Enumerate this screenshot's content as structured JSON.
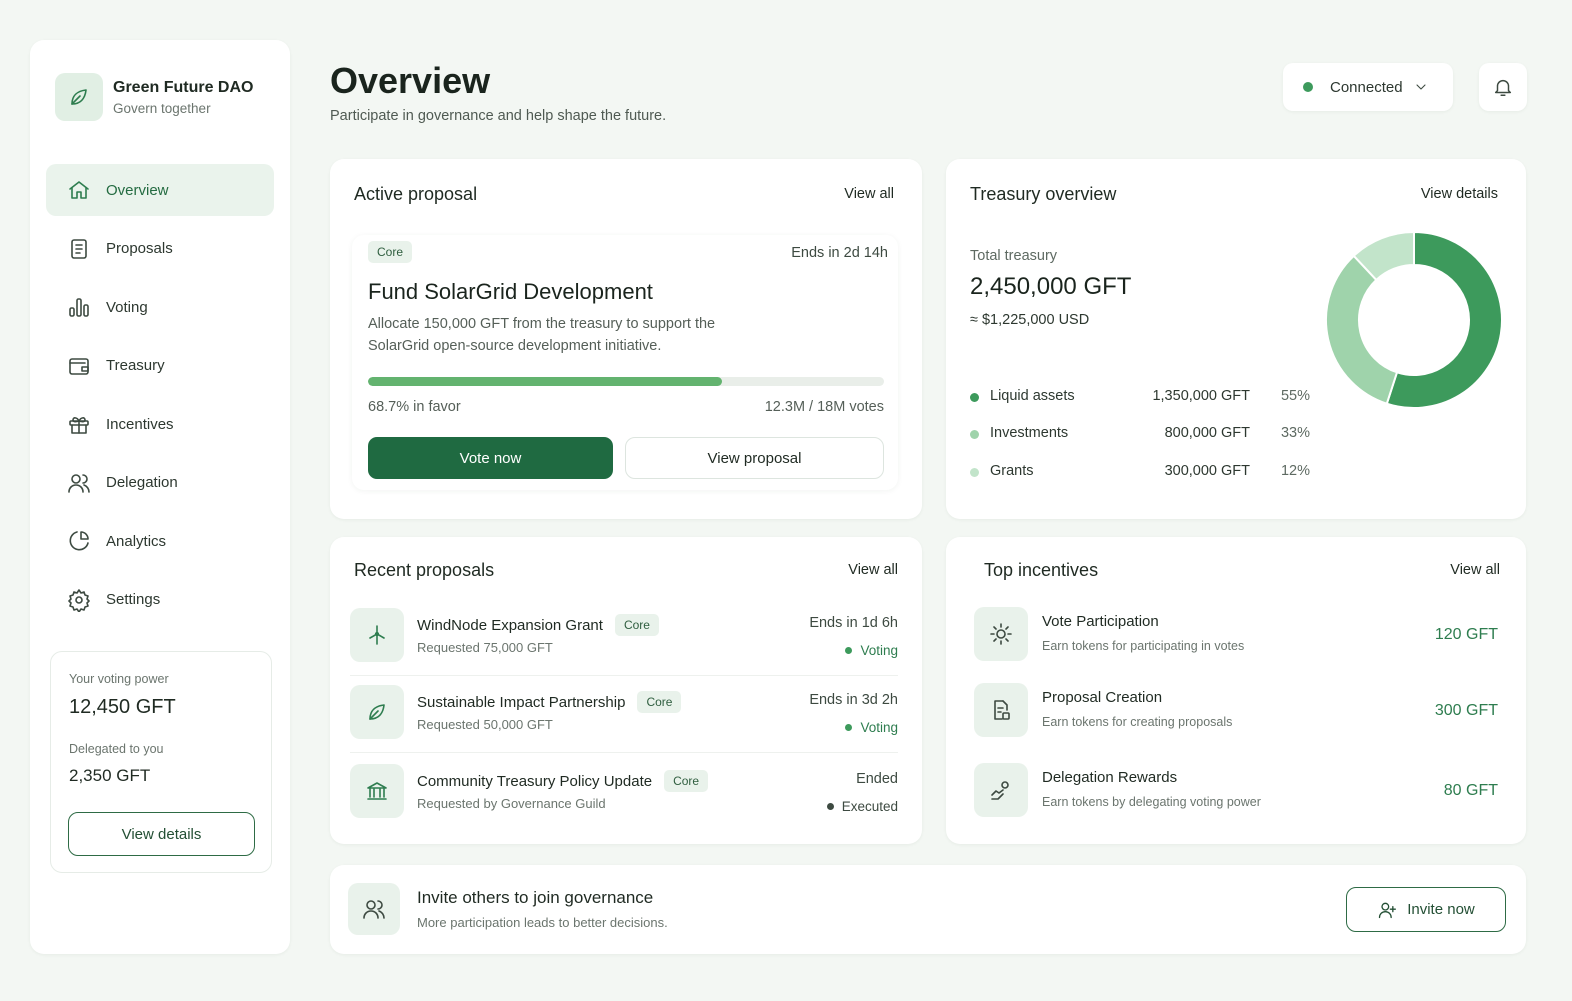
{
  "brand": {
    "name": "Green Future DAO",
    "tagline": "Govern together"
  },
  "nav": [
    {
      "label": "Overview",
      "icon": "home-icon",
      "active": true
    },
    {
      "label": "Proposals",
      "icon": "document-icon"
    },
    {
      "label": "Voting",
      "icon": "bar-chart-icon"
    },
    {
      "label": "Treasury",
      "icon": "wallet-icon"
    },
    {
      "label": "Incentives",
      "icon": "gift-icon"
    },
    {
      "label": "Delegation",
      "icon": "users-icon"
    },
    {
      "label": "Analytics",
      "icon": "pie-chart-icon"
    },
    {
      "label": "Settings",
      "icon": "gear-icon"
    }
  ],
  "voting_power": {
    "label": "Your voting power",
    "value": "12,450 GFT",
    "delegated_label": "Delegated to you",
    "delegated_value": "2,350 GFT",
    "button": "View details"
  },
  "header": {
    "title": "Overview",
    "subtitle": "Participate in governance and help shape the future.",
    "connection": "Connected"
  },
  "active_proposal": {
    "title": "Active proposal",
    "link": "View all",
    "tag": "Core",
    "ends": "Ends in 2d 14h",
    "name": "Fund SolarGrid Development",
    "desc_line1": "Allocate 150,000 GFT from the treasury to support the",
    "desc_line2": "SolarGrid open-source development initiative.",
    "progress": 0.687,
    "in_favor": "68.7% in favor",
    "votes": "12.3M / 18M votes",
    "vote_button": "Vote now",
    "view_button": "View proposal"
  },
  "treasury": {
    "title": "Treasury overview",
    "link": "View details",
    "total_label": "Total treasury",
    "total": "2,450,000 GFT",
    "usd": "≈ $1,225,000 USD",
    "breakdown": [
      {
        "name": "Liquid assets",
        "amount": "1,350,000 GFT",
        "pct": "55%",
        "value": 55,
        "color": "#3d9a5c"
      },
      {
        "name": "Investments",
        "amount": "800,000 GFT",
        "pct": "33%",
        "value": 33,
        "color": "#9fd3ab"
      },
      {
        "name": "Grants",
        "amount": "300,000 GFT",
        "pct": "12%",
        "value": 12,
        "color": "#c2e4ca"
      }
    ]
  },
  "recent": {
    "title": "Recent proposals",
    "link": "View all",
    "items": [
      {
        "title": "WindNode Expansion Grant",
        "tag": "Core",
        "sub": "Requested 75,000 GFT",
        "ends": "Ends in 1d 6h",
        "status": "Voting",
        "icon": "wind-turbine-icon",
        "status_color": "#3d9a5c"
      },
      {
        "title": "Sustainable Impact Partnership",
        "tag": "Core",
        "sub": "Requested 50,000 GFT",
        "ends": "Ends in 3d 2h",
        "status": "Voting",
        "icon": "leaf-icon",
        "status_color": "#3d9a5c"
      },
      {
        "title": "Community Treasury Policy Update",
        "tag": "Core",
        "sub": "Requested by Governance Guild",
        "ends": "Ended",
        "status": "Executed",
        "icon": "bank-icon",
        "status_color": "#3d4a41"
      }
    ]
  },
  "incentives": {
    "title": "Top incentives",
    "link": "View all",
    "items": [
      {
        "title": "Vote Participation",
        "sub": "Earn tokens for participating in votes",
        "amount": "120 GFT",
        "icon": "sun-icon"
      },
      {
        "title": "Proposal Creation",
        "sub": "Earn tokens for creating proposals",
        "amount": "300 GFT",
        "icon": "document-edit-icon"
      },
      {
        "title": "Delegation Rewards",
        "sub": "Earn tokens by delegating voting power",
        "amount": "80 GFT",
        "icon": "handshake-icon"
      }
    ]
  },
  "invite": {
    "title": "Invite others to join governance",
    "sub": "More participation leads to better decisions.",
    "button": "Invite now"
  },
  "colors": {
    "accent": "#1f6a41",
    "success": "#3d9a5c",
    "background": "#f3f7f3"
  }
}
